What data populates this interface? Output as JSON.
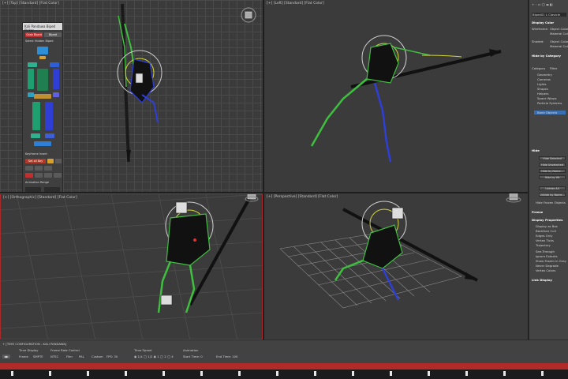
{
  "viewports": {
    "top": {
      "label": "[+] [Top] [Standard] [Flat Color]"
    },
    "left": {
      "label": "[+] [Left] [Standard] [Flat Color]"
    },
    "ortho": {
      "label": "[+] [Orthographic] [Standard] [Flat Color]"
    },
    "perspective": {
      "label": "[+] [Perspective] [Standard] [Flat Color]"
    }
  },
  "biped_panel": {
    "title": "Kali Pandawa Biped Picker",
    "tab_active": "Grab Biped",
    "tab_other": "Biped",
    "select_hidden": "Select Hidden Biped",
    "buttons": [
      "Head",
      "Neck",
      "L Clavicle",
      "R Clavicle",
      "L Upperarm",
      "R Upperarm",
      "Spine",
      "L Hand",
      "R Hand",
      "Pelvis",
      "L Thigh",
      "R Thigh",
      "L Foot",
      "R Foot",
      "COM"
    ],
    "keyframe_label": "Keyframe Insert",
    "set_all_key": "Set all Key",
    "anim_range": "Animation Range"
  },
  "command_panel": {
    "object_name": "Biped01 L Clavicle",
    "display_color": "Display Color",
    "wireframe": "Wireframe:",
    "shaded": "Shaded:",
    "object_color": "Object Color",
    "material_color": "Material Color",
    "hide_by_category": "Hide by Category",
    "category": "Category",
    "filter": "Filter",
    "categories": [
      "Geometry",
      "Cameras",
      "Lights",
      "Shapes",
      "Helpers",
      "Space Warps",
      "Particle Systems",
      "Bone Objects"
    ],
    "hide": "Hide",
    "hide_buttons": [
      "Hide Selected",
      "Hide Unselected",
      "Hide by Name...",
      "Hide by Hit",
      "Unhide All",
      "Unhide by Name...",
      "Hide Frozen Objects"
    ],
    "freeze": "Freeze",
    "display_properties": "Display Properties",
    "props": [
      "Display as Box",
      "Backface Cull",
      "Edges Only",
      "Vertex Ticks",
      "Trajectory",
      "See-Through",
      "Ignore Extents",
      "Show Frozen in Gray",
      "Never Degrade",
      "Vertex Colors"
    ],
    "link_display": "Link Display"
  },
  "bottom_panel": {
    "dialog_title": "+ [TIME CONFIGURATION - KALI PANDAWA]",
    "time_display": "Time Display",
    "frame_rate": "Frame Rate Control",
    "time_speed": "Time Speed",
    "animation": "Animation",
    "frame": "Frame",
    "smpte": "SMPTE",
    "ntsc": "NTSC",
    "film": "Film",
    "pal": "PAL",
    "custom": "Custom",
    "fps": "FPS: 30",
    "start_time": "Start Time: 0",
    "end_time": "End Time: 100"
  },
  "colors": {
    "viewport_bg": "#3b3b3b",
    "rig_green": "#3fbf3f",
    "rig_yellow": "#d4d43a",
    "rig_blue": "#2f3fd6",
    "timeline_red": "#b22a2a",
    "panel_bg": "#444444"
  }
}
